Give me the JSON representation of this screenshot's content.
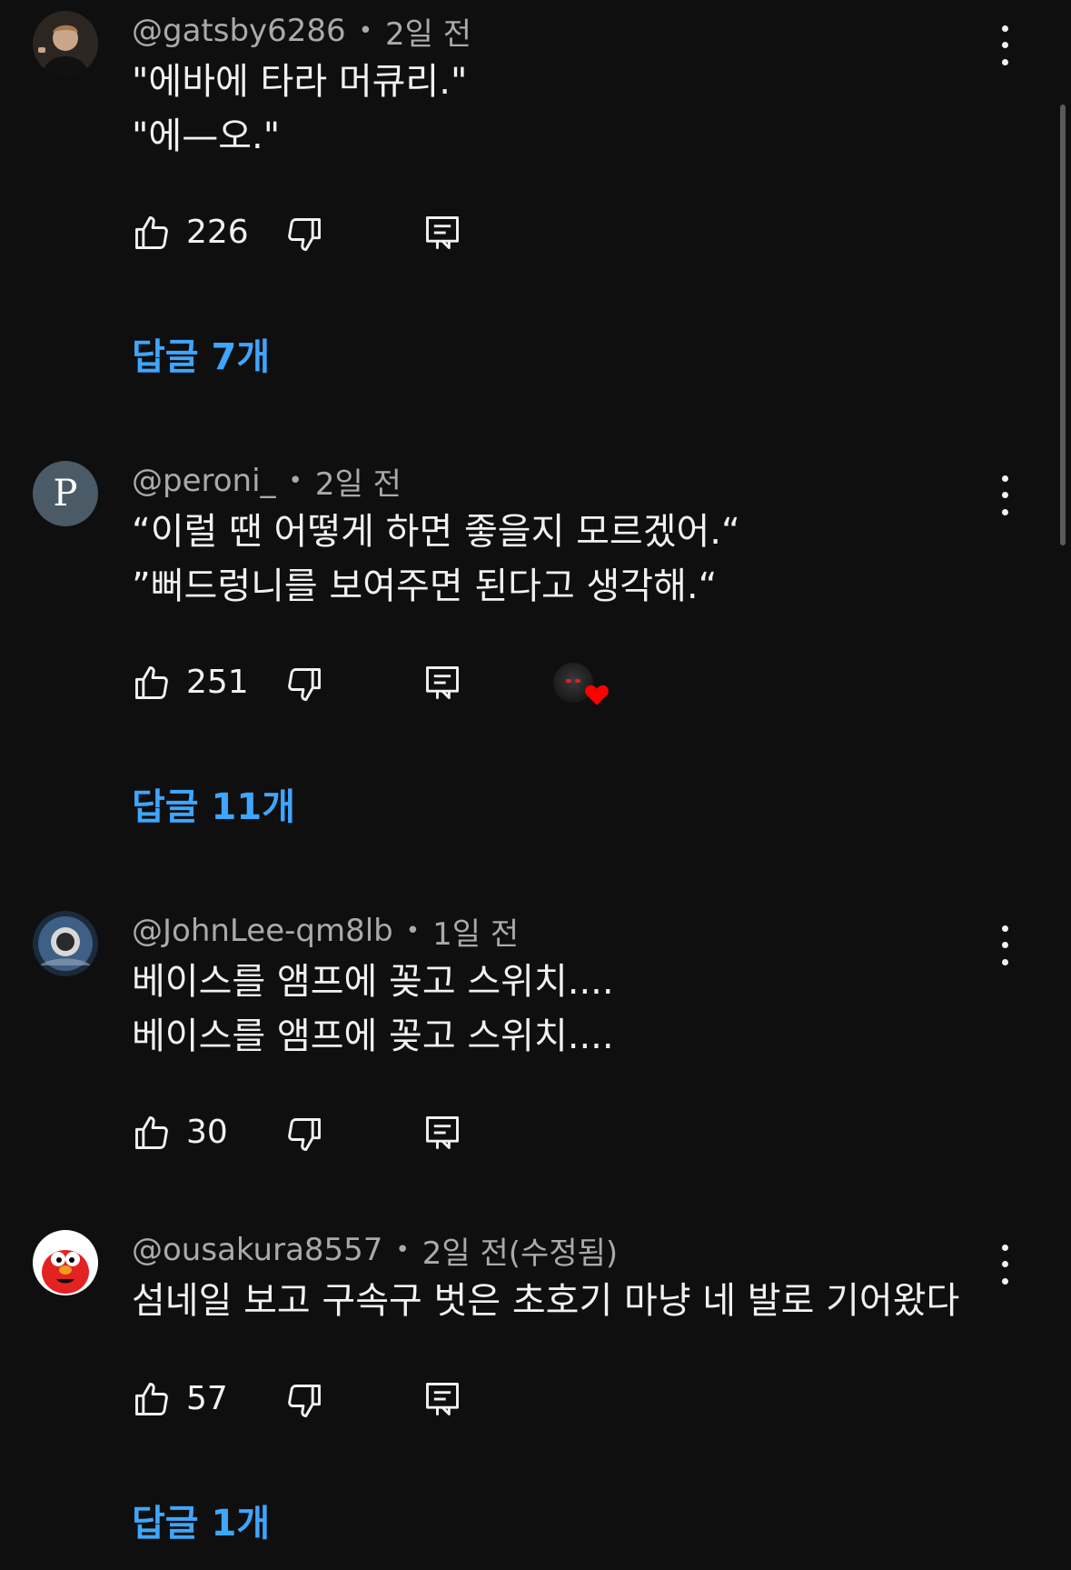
{
  "comments": [
    {
      "username": "@gatsby6286",
      "time": "2일 전",
      "lines": [
        "\"에바에 타라 머큐리.\"",
        "\"에—오.\""
      ],
      "likes": "226",
      "replies": "답글 7개"
    },
    {
      "username": "@peroni_",
      "time": "2일 전",
      "avatar_letter": "P",
      "lines": [
        "“이럴 땐 어떻게 하면 좋을지 모르겠어.“",
        "”뻐드렁니를 보여주면 된다고 생각해.“"
      ],
      "likes": "251",
      "replies": "답글 11개",
      "creator_heart": true
    },
    {
      "username": "@JohnLee-qm8lb",
      "time": "1일 전",
      "lines": [
        "베이스를 앰프에 꽂고 스위치....",
        "베이스를 앰프에 꽂고 스위치...."
      ],
      "likes": "30"
    },
    {
      "username": "@ousakura8557",
      "time": "2일 전(수정됨)",
      "lines": [
        "섬네일 보고 구속구 벗은 초호기 마냥 네 발로 기어왔다"
      ],
      "likes": "57",
      "replies": "답글 1개"
    }
  ],
  "icons": {
    "like": "thumb-up-icon",
    "dislike": "thumb-down-icon",
    "reply": "comment-reply-icon",
    "more": "more-vertical-icon",
    "heart": "creator-heart-icon"
  },
  "colors": {
    "background": "#0f0f0f",
    "text": "#f1f1f1",
    "meta": "#aaaaaa",
    "link": "#3ea6ff",
    "heart": "#ff0000"
  }
}
